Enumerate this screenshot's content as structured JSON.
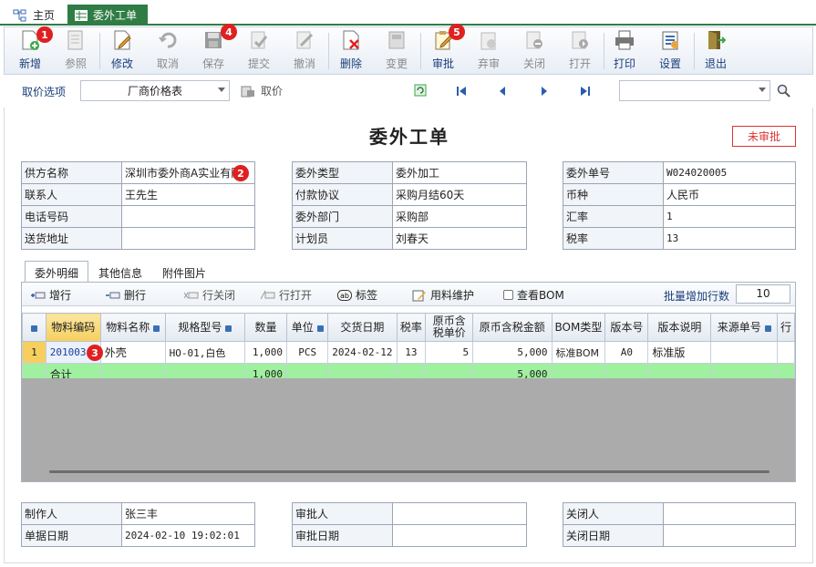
{
  "tabs": {
    "home": "主页",
    "active": "委外工单"
  },
  "toolbar": [
    {
      "label": "新增",
      "disabled": false,
      "icon": "new-doc-icon"
    },
    {
      "label": "参照",
      "disabled": true,
      "icon": "reference-icon"
    },
    {
      "label": "修改",
      "disabled": false,
      "icon": "edit-icon"
    },
    {
      "label": "取消",
      "disabled": true,
      "icon": "cancel-icon"
    },
    {
      "label": "保存",
      "disabled": true,
      "icon": "save-icon"
    },
    {
      "label": "提交",
      "disabled": true,
      "icon": "submit-icon"
    },
    {
      "label": "撤消",
      "disabled": true,
      "icon": "revoke-icon"
    },
    {
      "label": "删除",
      "disabled": false,
      "icon": "delete-icon"
    },
    {
      "label": "变更",
      "disabled": true,
      "icon": "change-icon"
    },
    {
      "label": "审批",
      "disabled": false,
      "icon": "approve-icon"
    },
    {
      "label": "弃审",
      "disabled": true,
      "icon": "unapprove-icon"
    },
    {
      "label": "关闭",
      "disabled": true,
      "icon": "close-doc-icon"
    },
    {
      "label": "打开",
      "disabled": true,
      "icon": "open-doc-icon"
    },
    {
      "label": "打印",
      "disabled": false,
      "icon": "print-icon"
    },
    {
      "label": "设置",
      "disabled": false,
      "icon": "settings-icon"
    },
    {
      "label": "退出",
      "disabled": false,
      "icon": "exit-icon"
    }
  ],
  "badges": [
    "1",
    "2",
    "3",
    "4",
    "5"
  ],
  "price_bar": {
    "label": "取价选项",
    "select": "厂商价格表",
    "fetch": "取价"
  },
  "doc": {
    "title": "委外工单",
    "status": "未审批"
  },
  "form_left": [
    {
      "label": "供方名称",
      "value": "深圳市委外商A实业有限"
    },
    {
      "label": "联系人",
      "value": "王先生"
    },
    {
      "label": "电话号码",
      "value": ""
    },
    {
      "label": "送货地址",
      "value": ""
    }
  ],
  "form_mid": [
    {
      "label": "委外类型",
      "value": "委外加工"
    },
    {
      "label": "付款协议",
      "value": "采购月结60天"
    },
    {
      "label": "委外部门",
      "value": "采购部"
    },
    {
      "label": "计划员",
      "value": "刘春天"
    }
  ],
  "form_right": [
    {
      "label": "委外单号",
      "value": "W024020005"
    },
    {
      "label": "币种",
      "value": "人民币"
    },
    {
      "label": "汇率",
      "value": "1"
    },
    {
      "label": "税率",
      "value": "13"
    }
  ],
  "subtabs": [
    "委外明细",
    "其他信息",
    "附件图片"
  ],
  "grid_toolbar": {
    "add": "增行",
    "del": "删行",
    "close_row": "行关闭",
    "open_row": "行打开",
    "tag": "标签",
    "material": "用料维护",
    "view_bom": "查看BOM",
    "batch_label": "批量增加行数",
    "batch_value": "10"
  },
  "grid_headers": [
    "物料编码",
    "物料名称",
    "规格型号",
    "数量",
    "单位",
    "交货日期",
    "税率",
    "原币含税单价",
    "原币含税金额",
    "BOM类型",
    "版本号",
    "版本说明",
    "来源单号",
    "行"
  ],
  "grid_rows": [
    {
      "idx": "1",
      "code": "201003",
      "name": "外壳",
      "spec": "HO-01,白色",
      "qty": "1,000",
      "unit": "PCS",
      "date": "2024-02-12",
      "tax": "13",
      "price": "5",
      "amount": "5,000",
      "bom": "标准BOM",
      "ver": "A0",
      "ver_desc": "标准版",
      "src": ""
    }
  ],
  "grid_total": {
    "label": "合计",
    "qty": "1,000",
    "amount": "5,000"
  },
  "footer_left": [
    {
      "label": "制作人",
      "value": "张三丰"
    },
    {
      "label": "单据日期",
      "value": "2024-02-10 19:02:01"
    }
  ],
  "footer_mid": [
    {
      "label": "审批人",
      "value": ""
    },
    {
      "label": "审批日期",
      "value": ""
    }
  ],
  "footer_right": [
    {
      "label": "关闭人",
      "value": ""
    },
    {
      "label": "关闭日期",
      "value": ""
    }
  ]
}
